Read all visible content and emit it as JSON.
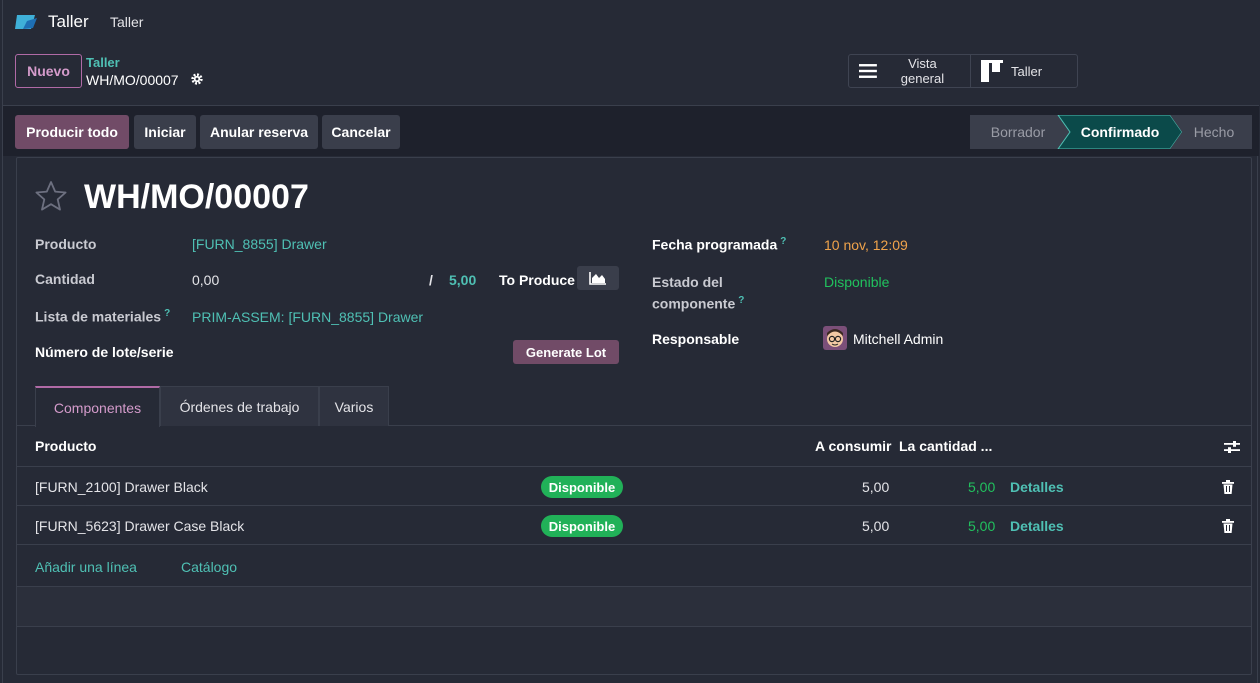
{
  "navbar": {
    "app_name": "Taller",
    "menu_item": "Taller"
  },
  "control": {
    "new_button": "Nuevo",
    "breadcrumb_parent": "Taller",
    "breadcrumb_current": "WH/MO/00007",
    "view_overview": "Vista general",
    "view_workshop": "Taller"
  },
  "actions": {
    "produce_all": "Producir todo",
    "start": "Iniciar",
    "unreserve": "Anular reserva",
    "cancel": "Cancelar"
  },
  "status": {
    "steps": [
      "Borrador",
      "Confirmado",
      "Hecho"
    ],
    "active": "Confirmado"
  },
  "form": {
    "title": "WH/MO/00007",
    "product_label": "Producto",
    "product_value": "[FURN_8855] Drawer",
    "quantity_label": "Cantidad",
    "quantity_value": "0,00",
    "quantity_separator": "/",
    "quantity_total": "5,00",
    "to_produce_label": "To Produce",
    "bom_label": "Lista de materiales",
    "bom_value": "PRIM-ASSEM: [FURN_8855] Drawer",
    "lot_label": "Número de lote/serie",
    "generate_lot": "Generate Lot",
    "date_label": "Fecha programada",
    "date_value": "10 nov, 12:09",
    "component_status_label_1": "Estado del",
    "component_status_label_2": "componente",
    "component_status_value": "Disponible",
    "responsible_label": "Responsable",
    "responsible_value": "Mitchell Admin",
    "help_mark": "?"
  },
  "tabs": [
    "Componentes",
    "Órdenes de trabajo",
    "Varios"
  ],
  "table": {
    "headers": {
      "product": "Producto",
      "to_consume": "A consumir",
      "quantity": "La cantidad ..."
    },
    "rows": [
      {
        "product": "[FURN_2100] Drawer Black",
        "status": "Disponible",
        "to_consume": "5,00",
        "quantity": "5,00",
        "details": "Detalles"
      },
      {
        "product": "[FURN_5623] Drawer Case Black",
        "status": "Disponible",
        "to_consume": "5,00",
        "quantity": "5,00",
        "details": "Detalles"
      }
    ],
    "add_line": "Añadir una línea",
    "catalog": "Catálogo"
  },
  "colors": {
    "accent": "#714b67",
    "link": "#4fc0b4",
    "success": "#21b158",
    "date": "#f0a34b",
    "background": "#262a36"
  },
  "icons": [
    "app-logo-icon",
    "gear-icon",
    "list-icon",
    "kanban-icon",
    "star-icon",
    "area-chart-icon",
    "avatar-icon",
    "column-settings-icon",
    "trash-icon"
  ]
}
